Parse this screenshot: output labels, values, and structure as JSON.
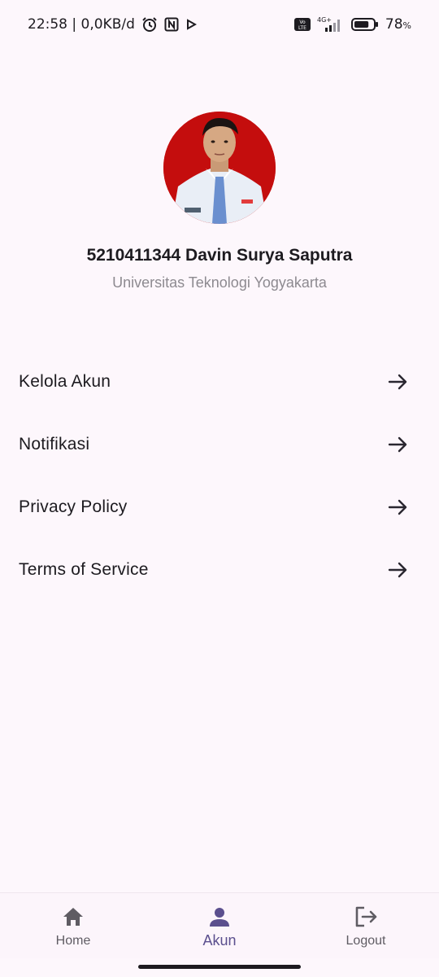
{
  "status_bar": {
    "time_and_speed": "22:58 | 0,0KB/d",
    "network_label": "4G+",
    "volte_label": "Vo LTE",
    "battery": "78",
    "battery_unit": "%",
    "battery_level": 0.78
  },
  "profile": {
    "name": "5210411344 Davin Surya Saputra",
    "subtitle": "Universitas Teknologi Yogyakarta"
  },
  "menu": {
    "items": [
      {
        "label": "Kelola Akun",
        "icon": "arrow-right-icon"
      },
      {
        "label": "Notifikasi",
        "icon": "arrow-right-icon"
      },
      {
        "label": "Privacy Policy",
        "icon": "arrow-right-icon"
      },
      {
        "label": "Terms of Service",
        "icon": "arrow-right-icon"
      }
    ]
  },
  "bottom_nav": {
    "items": [
      {
        "label": "Home",
        "icon": "home-icon",
        "active": false
      },
      {
        "label": "Akun",
        "icon": "person-icon",
        "active": true
      },
      {
        "label": "Logout",
        "icon": "logout-icon",
        "active": false
      }
    ]
  },
  "colors": {
    "background": "#fdf7fc",
    "accent": "#5b4f8e",
    "avatar_bg": "#c40d0d",
    "subtitle": "#8d8a90"
  }
}
